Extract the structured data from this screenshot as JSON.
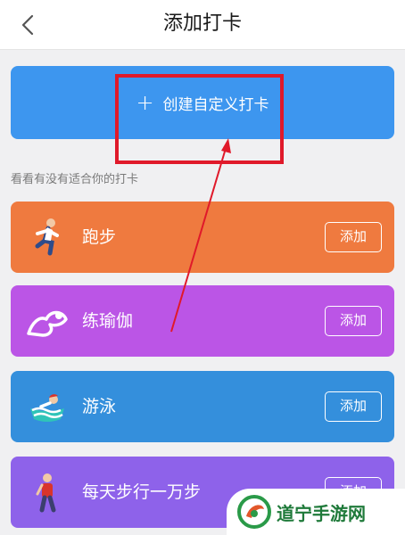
{
  "header": {
    "title": "添加打卡",
    "back_icon": "chevron-left-icon"
  },
  "create": {
    "plus": "+",
    "label": "创建自定义打卡",
    "color": "#3d96ef"
  },
  "section_label": "看看有没有适合你的打卡",
  "cards": [
    {
      "label": "跑步",
      "button": "添加",
      "color": "#ef7a3f",
      "icon": "running-person-icon"
    },
    {
      "label": "练瑜伽",
      "button": "添加",
      "color": "#bb55e6",
      "icon": "yoga-icon"
    },
    {
      "label": "游泳",
      "button": "添加",
      "color": "#348fdc",
      "icon": "swimming-icon"
    },
    {
      "label": "每天步行一万步",
      "button": "添加",
      "color": "#8e62ea",
      "icon": "walking-person-icon"
    }
  ],
  "annotation": {
    "color": "#e0192a"
  },
  "watermark": {
    "text": "道宁手游网",
    "icon": "watermark-logo-icon"
  }
}
